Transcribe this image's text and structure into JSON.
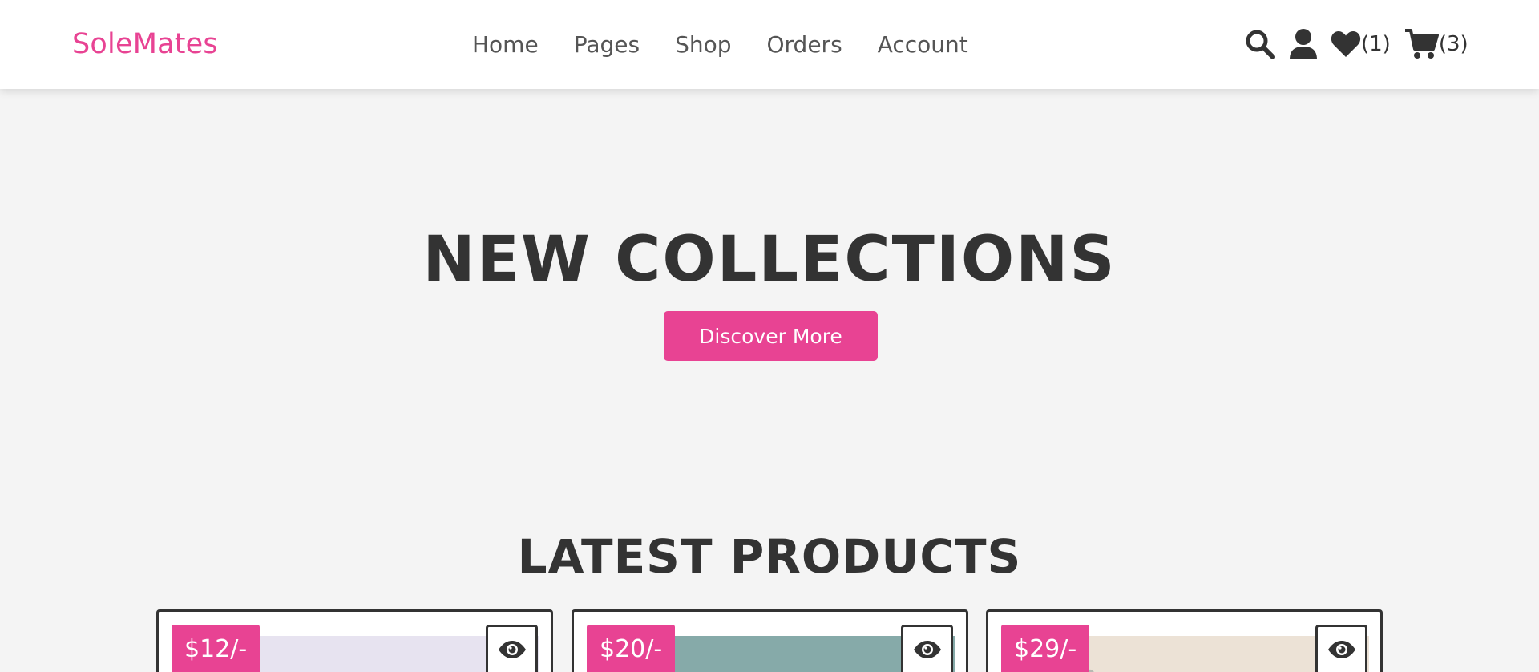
{
  "header": {
    "logo": "SoleMates",
    "nav": [
      "Home",
      "Pages",
      "Shop",
      "Orders",
      "Account"
    ],
    "icons": {
      "search": "search-icon",
      "user": "user-icon",
      "wishlist": "heart-icon",
      "cart": "cart-icon"
    },
    "wishlist_count": "(1)",
    "cart_count": "(3)"
  },
  "hero": {
    "title": "NEW COLLECTIONS",
    "button": "Discover More"
  },
  "products_section": {
    "title": "LATEST PRODUCTS",
    "products": [
      {
        "price": "$12/-",
        "image_bg": "#e7e3f0"
      },
      {
        "price": "$20/-",
        "image_bg": "#86aaa9"
      },
      {
        "price": "$29/-",
        "image_bg": "#ece2d6"
      }
    ]
  },
  "colors": {
    "accent": "#e84393",
    "text": "#333333",
    "background": "#f4f4f4"
  }
}
